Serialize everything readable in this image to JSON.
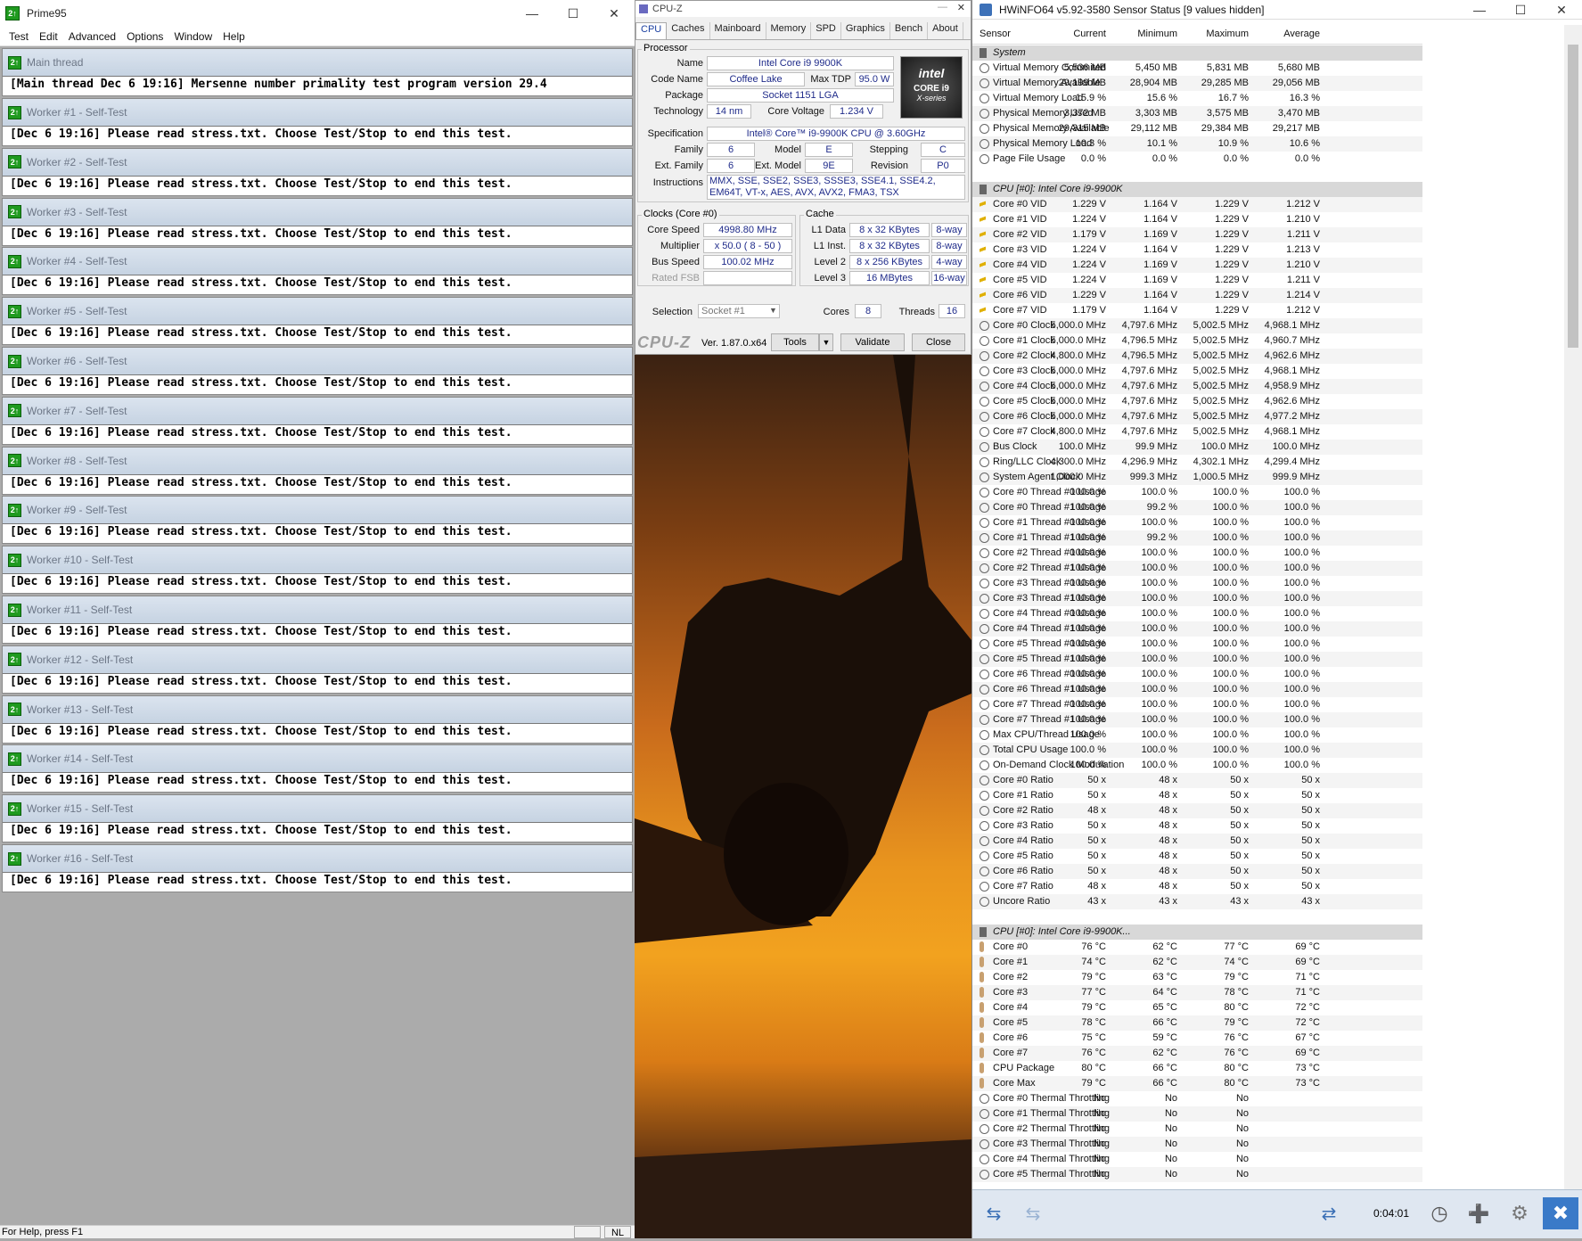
{
  "prime95": {
    "title": "Prime95",
    "app_icon": "2↑",
    "menu": [
      "Test",
      "Edit",
      "Advanced",
      "Options",
      "Window",
      "Help"
    ],
    "main_thread": {
      "title": "Main thread",
      "line": "[Main thread Dec 6 19:16] Mersenne number primality test program version 29.4"
    },
    "workers": [
      {
        "title": "Worker #1 - Self-Test",
        "line": "[Dec 6 19:16] Please read stress.txt.  Choose Test/Stop to end this test."
      },
      {
        "title": "Worker #2 - Self-Test",
        "line": "[Dec 6 19:16] Please read stress.txt.  Choose Test/Stop to end this test."
      },
      {
        "title": "Worker #3 - Self-Test",
        "line": "[Dec 6 19:16] Please read stress.txt.  Choose Test/Stop to end this test."
      },
      {
        "title": "Worker #4 - Self-Test",
        "line": "[Dec 6 19:16] Please read stress.txt.  Choose Test/Stop to end this test."
      },
      {
        "title": "Worker #5 - Self-Test",
        "line": "[Dec 6 19:16] Please read stress.txt.  Choose Test/Stop to end this test."
      },
      {
        "title": "Worker #6 - Self-Test",
        "line": "[Dec 6 19:16] Please read stress.txt.  Choose Test/Stop to end this test."
      },
      {
        "title": "Worker #7 - Self-Test",
        "line": "[Dec 6 19:16] Please read stress.txt.  Choose Test/Stop to end this test."
      },
      {
        "title": "Worker #8 - Self-Test",
        "line": "[Dec 6 19:16] Please read stress.txt.  Choose Test/Stop to end this test."
      },
      {
        "title": "Worker #9 - Self-Test",
        "line": "[Dec 6 19:16] Please read stress.txt.  Choose Test/Stop to end this test."
      },
      {
        "title": "Worker #10 - Self-Test",
        "line": "[Dec 6 19:16] Please read stress.txt.  Choose Test/Stop to end this test."
      },
      {
        "title": "Worker #11 - Self-Test",
        "line": "[Dec 6 19:16] Please read stress.txt.  Choose Test/Stop to end this test."
      },
      {
        "title": "Worker #12 - Self-Test",
        "line": "[Dec 6 19:16] Please read stress.txt.  Choose Test/Stop to end this test."
      },
      {
        "title": "Worker #13 - Self-Test",
        "line": "[Dec 6 19:16] Please read stress.txt.  Choose Test/Stop to end this test."
      },
      {
        "title": "Worker #14 - Self-Test",
        "line": "[Dec 6 19:16] Please read stress.txt.  Choose Test/Stop to end this test."
      },
      {
        "title": "Worker #15 - Self-Test",
        "line": "[Dec 6 19:16] Please read stress.txt.  Choose Test/Stop to end this test."
      },
      {
        "title": "Worker #16 - Self-Test",
        "line": "[Dec 6 19:16] Please read stress.txt.  Choose Test/Stop to end this test."
      }
    ],
    "status": "For Help, press F1",
    "status_nl": "NL"
  },
  "cpuz": {
    "title": "CPU-Z",
    "tabs": [
      "CPU",
      "Caches",
      "Mainboard",
      "Memory",
      "SPD",
      "Graphics",
      "Bench",
      "About"
    ],
    "processor_label": "Processor",
    "name_label": "Name",
    "name": "Intel Core i9 9900K",
    "codename_label": "Code Name",
    "codename": "Coffee Lake",
    "maxtdp_label": "Max TDP",
    "maxtdp": "95.0 W",
    "package_label": "Package",
    "package": "Socket 1151 LGA",
    "technology_label": "Technology",
    "technology": "14 nm",
    "corevoltage_label": "Core Voltage",
    "corevoltage": "1.234 V",
    "spec_label": "Specification",
    "spec": "Intel® Core™ i9-9900K CPU @ 3.60GHz",
    "family_label": "Family",
    "family": "6",
    "model_label": "Model",
    "model": "E",
    "stepping_label": "Stepping",
    "stepping": "C",
    "extfamily_label": "Ext. Family",
    "extfamily": "6",
    "extmodel_label": "Ext. Model",
    "extmodel": "9E",
    "revision_label": "Revision",
    "revision": "P0",
    "instructions_label": "Instructions",
    "instructions": "MMX, SSE, SSE2, SSE3, SSSE3, SSE4.1, SSE4.2, EM64T, VT-x, AES, AVX, AVX2, FMA3, TSX",
    "clocks_label": "Clocks (Core #0)",
    "corespeed_label": "Core Speed",
    "corespeed": "4998.80 MHz",
    "multiplier_label": "Multiplier",
    "multiplier": "x 50.0 ( 8 - 50 )",
    "busspeed_label": "Bus Speed",
    "busspeed": "100.02 MHz",
    "ratedfsb_label": "Rated FSB",
    "cache_label": "Cache",
    "l1d_label": "L1 Data",
    "l1d": "8 x 32 KBytes",
    "l1d_way": "8-way",
    "l1i_label": "L1 Inst.",
    "l1i": "8 x 32 KBytes",
    "l1i_way": "8-way",
    "l2_label": "Level 2",
    "l2": "8 x 256 KBytes",
    "l2_way": "4-way",
    "l3_label": "Level 3",
    "l3": "16 MBytes",
    "l3_way": "16-way",
    "selection_label": "Selection",
    "selection": "Socket #1",
    "cores_label": "Cores",
    "cores": "8",
    "threads_label": "Threads",
    "threads": "16",
    "logo_text": "CPU-Z",
    "version": "Ver. 1.87.0.x64",
    "tools_btn": "Tools",
    "validate_btn": "Validate",
    "close_btn": "Close",
    "intel_badge": {
      "brand": "intel",
      "line1": "CORE i9",
      "line2": "X-series"
    }
  },
  "hwinfo": {
    "title": "HWiNFO64 v5.92-3580 Sensor Status [9 values hidden]",
    "columns": [
      "Sensor",
      "Current",
      "Minimum",
      "Maximum",
      "Average"
    ],
    "elapsed": "0:04:01",
    "rows": [
      {
        "type": "group",
        "name": "System"
      },
      {
        "icon": "circle",
        "name": "Virtual Memory Commited",
        "v": [
          "5,536 MB",
          "5,450 MB",
          "5,831 MB",
          "5,680 MB"
        ]
      },
      {
        "icon": "circle",
        "name": "Virtual Memory Available",
        "v": [
          "29,199 MB",
          "28,904 MB",
          "29,285 MB",
          "29,056 MB"
        ]
      },
      {
        "icon": "circle",
        "name": "Virtual Memory Load",
        "v": [
          "15.9 %",
          "15.6 %",
          "16.7 %",
          "16.3 %"
        ]
      },
      {
        "icon": "circle",
        "name": "Physical Memory Used",
        "v": [
          "3,372 MB",
          "3,303 MB",
          "3,575 MB",
          "3,470 MB"
        ]
      },
      {
        "icon": "circle",
        "name": "Physical Memory Available",
        "v": [
          "29,315 MB",
          "29,112 MB",
          "29,384 MB",
          "29,217 MB"
        ]
      },
      {
        "icon": "circle",
        "name": "Physical Memory Load",
        "v": [
          "10.3 %",
          "10.1 %",
          "10.9 %",
          "10.6 %"
        ]
      },
      {
        "icon": "circle",
        "name": "Page File Usage",
        "v": [
          "0.0 %",
          "0.0 %",
          "0.0 %",
          "0.0 %"
        ]
      },
      {
        "type": "blank"
      },
      {
        "type": "group",
        "name": "CPU [#0]: Intel Core i9-9900K"
      },
      {
        "icon": "volt",
        "name": "Core #0 VID",
        "v": [
          "1.229 V",
          "1.164 V",
          "1.229 V",
          "1.212 V"
        ]
      },
      {
        "icon": "volt",
        "name": "Core #1 VID",
        "v": [
          "1.224 V",
          "1.164 V",
          "1.229 V",
          "1.210 V"
        ]
      },
      {
        "icon": "volt",
        "name": "Core #2 VID",
        "v": [
          "1.179 V",
          "1.169 V",
          "1.229 V",
          "1.211 V"
        ]
      },
      {
        "icon": "volt",
        "name": "Core #3 VID",
        "v": [
          "1.224 V",
          "1.164 V",
          "1.229 V",
          "1.213 V"
        ]
      },
      {
        "icon": "volt",
        "name": "Core #4 VID",
        "v": [
          "1.224 V",
          "1.169 V",
          "1.229 V",
          "1.210 V"
        ]
      },
      {
        "icon": "volt",
        "name": "Core #5 VID",
        "v": [
          "1.224 V",
          "1.169 V",
          "1.229 V",
          "1.211 V"
        ]
      },
      {
        "icon": "volt",
        "name": "Core #6 VID",
        "v": [
          "1.229 V",
          "1.164 V",
          "1.229 V",
          "1.214 V"
        ]
      },
      {
        "icon": "volt",
        "name": "Core #7 VID",
        "v": [
          "1.179 V",
          "1.164 V",
          "1.229 V",
          "1.212 V"
        ]
      },
      {
        "icon": "circle",
        "name": "Core #0 Clock",
        "v": [
          "5,000.0 MHz",
          "4,797.6 MHz",
          "5,002.5 MHz",
          "4,968.1 MHz"
        ]
      },
      {
        "icon": "circle",
        "name": "Core #1 Clock",
        "v": [
          "5,000.0 MHz",
          "4,796.5 MHz",
          "5,002.5 MHz",
          "4,960.7 MHz"
        ]
      },
      {
        "icon": "circle",
        "name": "Core #2 Clock",
        "v": [
          "4,800.0 MHz",
          "4,796.5 MHz",
          "5,002.5 MHz",
          "4,962.6 MHz"
        ]
      },
      {
        "icon": "circle",
        "name": "Core #3 Clock",
        "v": [
          "5,000.0 MHz",
          "4,797.6 MHz",
          "5,002.5 MHz",
          "4,968.1 MHz"
        ]
      },
      {
        "icon": "circle",
        "name": "Core #4 Clock",
        "v": [
          "5,000.0 MHz",
          "4,797.6 MHz",
          "5,002.5 MHz",
          "4,958.9 MHz"
        ]
      },
      {
        "icon": "circle",
        "name": "Core #5 Clock",
        "v": [
          "5,000.0 MHz",
          "4,797.6 MHz",
          "5,002.5 MHz",
          "4,962.6 MHz"
        ]
      },
      {
        "icon": "circle",
        "name": "Core #6 Clock",
        "v": [
          "5,000.0 MHz",
          "4,797.6 MHz",
          "5,002.5 MHz",
          "4,977.2 MHz"
        ]
      },
      {
        "icon": "circle",
        "name": "Core #7 Clock",
        "v": [
          "4,800.0 MHz",
          "4,797.6 MHz",
          "5,002.5 MHz",
          "4,968.1 MHz"
        ]
      },
      {
        "icon": "circle",
        "name": "Bus Clock",
        "v": [
          "100.0 MHz",
          "99.9 MHz",
          "100.0 MHz",
          "100.0 MHz"
        ]
      },
      {
        "icon": "circle",
        "name": "Ring/LLC Clock",
        "v": [
          "4,300.0 MHz",
          "4,296.9 MHz",
          "4,302.1 MHz",
          "4,299.4 MHz"
        ]
      },
      {
        "icon": "circle",
        "name": "System Agent Clock",
        "v": [
          "1,000.0 MHz",
          "999.3 MHz",
          "1,000.5 MHz",
          "999.9 MHz"
        ]
      },
      {
        "icon": "circle",
        "name": "Core #0 Thread #0 Usage",
        "v": [
          "100.0 %",
          "100.0 %",
          "100.0 %",
          "100.0 %"
        ]
      },
      {
        "icon": "circle",
        "name": "Core #0 Thread #1 Usage",
        "v": [
          "100.0 %",
          "99.2 %",
          "100.0 %",
          "100.0 %"
        ]
      },
      {
        "icon": "circle",
        "name": "Core #1 Thread #0 Usage",
        "v": [
          "100.0 %",
          "100.0 %",
          "100.0 %",
          "100.0 %"
        ]
      },
      {
        "icon": "circle",
        "name": "Core #1 Thread #1 Usage",
        "v": [
          "100.0 %",
          "99.2 %",
          "100.0 %",
          "100.0 %"
        ]
      },
      {
        "icon": "circle",
        "name": "Core #2 Thread #0 Usage",
        "v": [
          "100.0 %",
          "100.0 %",
          "100.0 %",
          "100.0 %"
        ]
      },
      {
        "icon": "circle",
        "name": "Core #2 Thread #1 Usage",
        "v": [
          "100.0 %",
          "100.0 %",
          "100.0 %",
          "100.0 %"
        ]
      },
      {
        "icon": "circle",
        "name": "Core #3 Thread #0 Usage",
        "v": [
          "100.0 %",
          "100.0 %",
          "100.0 %",
          "100.0 %"
        ]
      },
      {
        "icon": "circle",
        "name": "Core #3 Thread #1 Usage",
        "v": [
          "100.0 %",
          "100.0 %",
          "100.0 %",
          "100.0 %"
        ]
      },
      {
        "icon": "circle",
        "name": "Core #4 Thread #0 Usage",
        "v": [
          "100.0 %",
          "100.0 %",
          "100.0 %",
          "100.0 %"
        ]
      },
      {
        "icon": "circle",
        "name": "Core #4 Thread #1 Usage",
        "v": [
          "100.0 %",
          "100.0 %",
          "100.0 %",
          "100.0 %"
        ]
      },
      {
        "icon": "circle",
        "name": "Core #5 Thread #0 Usage",
        "v": [
          "100.0 %",
          "100.0 %",
          "100.0 %",
          "100.0 %"
        ]
      },
      {
        "icon": "circle",
        "name": "Core #5 Thread #1 Usage",
        "v": [
          "100.0 %",
          "100.0 %",
          "100.0 %",
          "100.0 %"
        ]
      },
      {
        "icon": "circle",
        "name": "Core #6 Thread #0 Usage",
        "v": [
          "100.0 %",
          "100.0 %",
          "100.0 %",
          "100.0 %"
        ]
      },
      {
        "icon": "circle",
        "name": "Core #6 Thread #1 Usage",
        "v": [
          "100.0 %",
          "100.0 %",
          "100.0 %",
          "100.0 %"
        ]
      },
      {
        "icon": "circle",
        "name": "Core #7 Thread #0 Usage",
        "v": [
          "100.0 %",
          "100.0 %",
          "100.0 %",
          "100.0 %"
        ]
      },
      {
        "icon": "circle",
        "name": "Core #7 Thread #1 Usage",
        "v": [
          "100.0 %",
          "100.0 %",
          "100.0 %",
          "100.0 %"
        ]
      },
      {
        "icon": "circle",
        "name": "Max CPU/Thread Usage",
        "v": [
          "100.0 %",
          "100.0 %",
          "100.0 %",
          "100.0 %"
        ]
      },
      {
        "icon": "circle",
        "name": "Total CPU Usage",
        "v": [
          "100.0 %",
          "100.0 %",
          "100.0 %",
          "100.0 %"
        ]
      },
      {
        "icon": "circle",
        "name": "On-Demand Clock Modulation",
        "v": [
          "100.0 %",
          "100.0 %",
          "100.0 %",
          "100.0 %"
        ]
      },
      {
        "icon": "circle",
        "name": "Core #0 Ratio",
        "v": [
          "50 x",
          "48 x",
          "50 x",
          "50 x"
        ]
      },
      {
        "icon": "circle",
        "name": "Core #1 Ratio",
        "v": [
          "50 x",
          "48 x",
          "50 x",
          "50 x"
        ]
      },
      {
        "icon": "circle",
        "name": "Core #2 Ratio",
        "v": [
          "48 x",
          "48 x",
          "50 x",
          "50 x"
        ]
      },
      {
        "icon": "circle",
        "name": "Core #3 Ratio",
        "v": [
          "50 x",
          "48 x",
          "50 x",
          "50 x"
        ]
      },
      {
        "icon": "circle",
        "name": "Core #4 Ratio",
        "v": [
          "50 x",
          "48 x",
          "50 x",
          "50 x"
        ]
      },
      {
        "icon": "circle",
        "name": "Core #5 Ratio",
        "v": [
          "50 x",
          "48 x",
          "50 x",
          "50 x"
        ]
      },
      {
        "icon": "circle",
        "name": "Core #6 Ratio",
        "v": [
          "50 x",
          "48 x",
          "50 x",
          "50 x"
        ]
      },
      {
        "icon": "circle",
        "name": "Core #7 Ratio",
        "v": [
          "48 x",
          "48 x",
          "50 x",
          "50 x"
        ]
      },
      {
        "icon": "circle",
        "name": "Uncore Ratio",
        "v": [
          "43 x",
          "43 x",
          "43 x",
          "43 x"
        ]
      },
      {
        "type": "blank"
      },
      {
        "type": "group",
        "name": "CPU [#0]: Intel Core i9-9900K..."
      },
      {
        "icon": "temp",
        "name": "Core #0",
        "v": [
          "76 °C",
          "62 °C",
          "77 °C",
          "69 °C"
        ]
      },
      {
        "icon": "temp",
        "name": "Core #1",
        "v": [
          "74 °C",
          "62 °C",
          "74 °C",
          "69 °C"
        ]
      },
      {
        "icon": "temp",
        "name": "Core #2",
        "v": [
          "79 °C",
          "63 °C",
          "79 °C",
          "71 °C"
        ]
      },
      {
        "icon": "temp",
        "name": "Core #3",
        "v": [
          "77 °C",
          "64 °C",
          "78 °C",
          "71 °C"
        ]
      },
      {
        "icon": "temp",
        "name": "Core #4",
        "v": [
          "79 °C",
          "65 °C",
          "80 °C",
          "72 °C"
        ]
      },
      {
        "icon": "temp",
        "name": "Core #5",
        "v": [
          "78 °C",
          "66 °C",
          "79 °C",
          "72 °C"
        ]
      },
      {
        "icon": "temp",
        "name": "Core #6",
        "v": [
          "75 °C",
          "59 °C",
          "76 °C",
          "67 °C"
        ]
      },
      {
        "icon": "temp",
        "name": "Core #7",
        "v": [
          "76 °C",
          "62 °C",
          "76 °C",
          "69 °C"
        ]
      },
      {
        "icon": "temp",
        "name": "CPU Package",
        "v": [
          "80 °C",
          "66 °C",
          "80 °C",
          "73 °C"
        ]
      },
      {
        "icon": "temp",
        "name": "Core Max",
        "v": [
          "79 °C",
          "66 °C",
          "80 °C",
          "73 °C"
        ]
      },
      {
        "icon": "circle",
        "name": "Core #0 Thermal Throttling",
        "v": [
          "No",
          "No",
          "No",
          ""
        ]
      },
      {
        "icon": "circle",
        "name": "Core #1 Thermal Throttling",
        "v": [
          "No",
          "No",
          "No",
          ""
        ]
      },
      {
        "icon": "circle",
        "name": "Core #2 Thermal Throttling",
        "v": [
          "No",
          "No",
          "No",
          ""
        ]
      },
      {
        "icon": "circle",
        "name": "Core #3 Thermal Throttling",
        "v": [
          "No",
          "No",
          "No",
          ""
        ]
      },
      {
        "icon": "circle",
        "name": "Core #4 Thermal Throttling",
        "v": [
          "No",
          "No",
          "No",
          ""
        ]
      },
      {
        "icon": "circle",
        "name": "Core #5 Thermal Throttling",
        "v": [
          "No",
          "No",
          "No",
          ""
        ]
      }
    ]
  }
}
